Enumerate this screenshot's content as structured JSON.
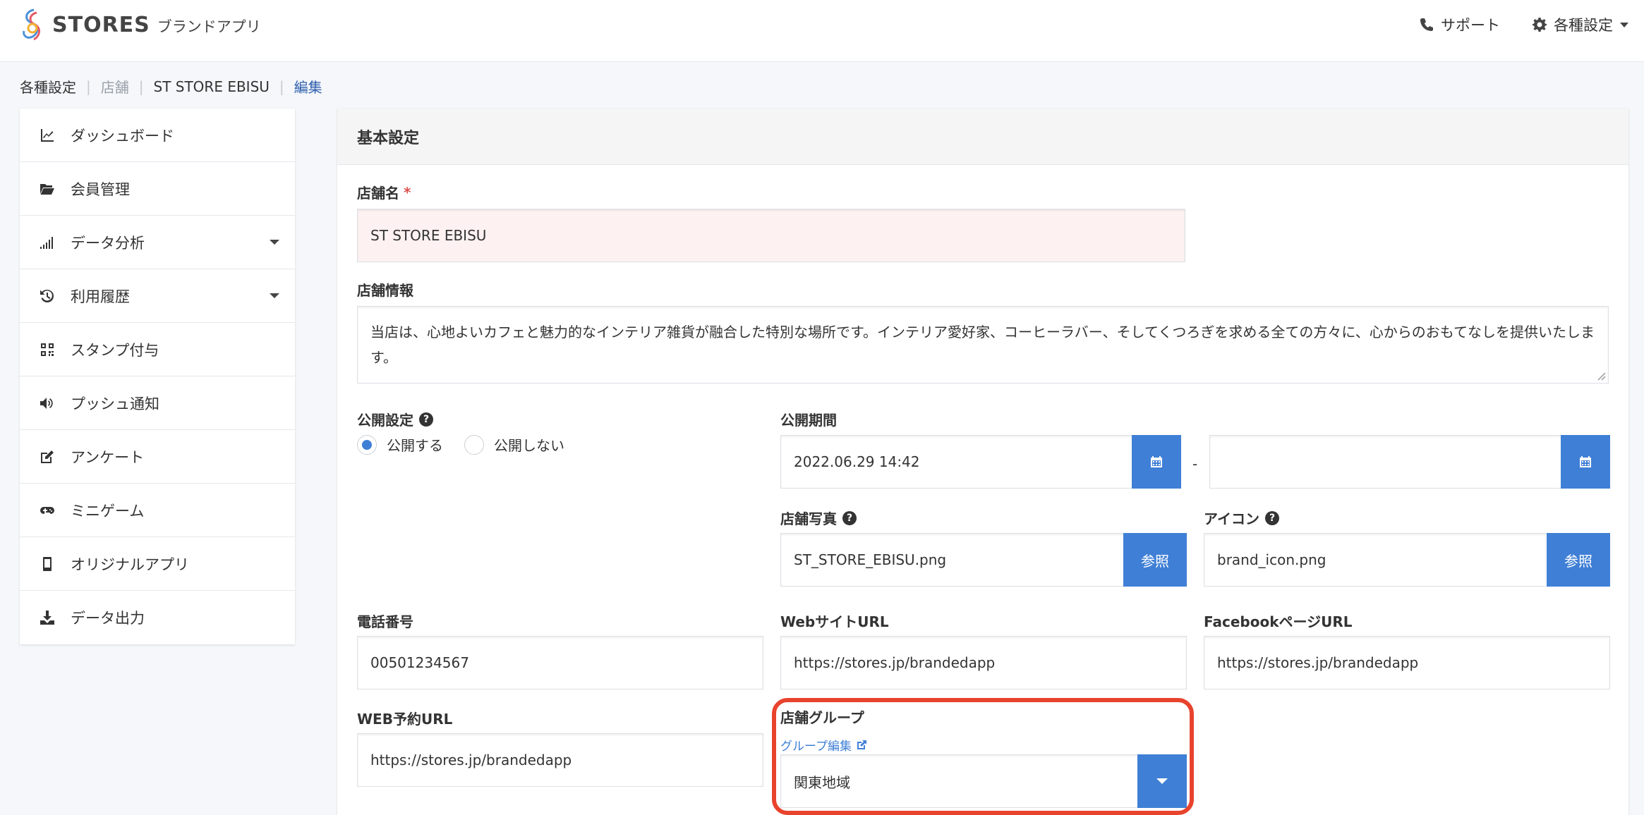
{
  "header": {
    "logo_text": "STORES",
    "logo_sub": "ブランドアプリ",
    "support_label": "サポート",
    "settings_label": "各種設定"
  },
  "breadcrumb": [
    "各種設定",
    "店舗",
    "ST STORE EBISU",
    "編集"
  ],
  "sidebar": {
    "items": [
      {
        "label": "ダッシュボード"
      },
      {
        "label": "会員管理"
      },
      {
        "label": "データ分析"
      },
      {
        "label": "利用履歴"
      },
      {
        "label": "スタンプ付与"
      },
      {
        "label": "プッシュ通知"
      },
      {
        "label": "アンケート"
      },
      {
        "label": "ミニゲーム"
      },
      {
        "label": "オリジナルアプリ"
      },
      {
        "label": "データ出力"
      }
    ]
  },
  "panel": {
    "title": "基本設定",
    "store_name": {
      "label": "店舗名",
      "required_mark": "*",
      "value": "ST STORE EBISU"
    },
    "store_info": {
      "label": "店舗情報",
      "value": "当店は、心地よいカフェと魅力的なインテリア雑貨が融合した特別な場所です。インテリア愛好家、コーヒーラバー、そしてくつろぎを求める全ての方々に、心からのおもてなしを提供いたします。"
    },
    "publish": {
      "label": "公開設定",
      "option_public": "公開する",
      "option_private": "公開しない"
    },
    "period": {
      "label": "公開期間",
      "start": "2022.06.29 14:42",
      "separator": "-",
      "end": ""
    },
    "photo": {
      "label": "店舗写真",
      "value": "ST_STORE_EBISU.png",
      "button": "参照"
    },
    "icon": {
      "label": "アイコン",
      "value": "brand_icon.png",
      "button": "参照"
    },
    "phone": {
      "label": "電話番号",
      "value": "00501234567"
    },
    "website": {
      "label": "WebサイトURL",
      "value": "https://stores.jp/brandedapp"
    },
    "facebook": {
      "label": "FacebookページURL",
      "value": "https://stores.jp/brandedapp"
    },
    "reserve": {
      "label": "WEB予約URL",
      "value": "https://stores.jp/brandedapp"
    },
    "group": {
      "label": "店舗グループ",
      "edit_link": "グループ編集",
      "value": "関東地域"
    }
  },
  "colors": {
    "accent": "#3f7fd6",
    "highlight": "#e8432d"
  }
}
